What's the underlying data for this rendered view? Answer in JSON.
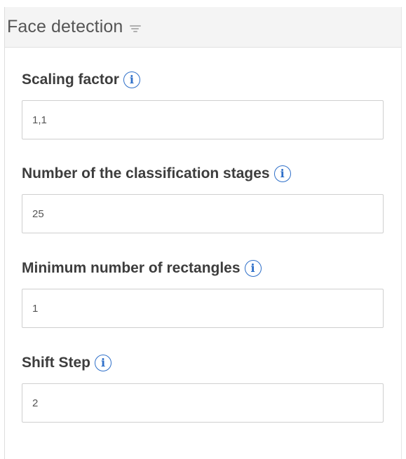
{
  "panel": {
    "title": "Face detection",
    "collapse_icon": "collapse-menu-icon"
  },
  "fields": [
    {
      "label": "Scaling factor",
      "value": "1,1",
      "info_icon": "info-icon"
    },
    {
      "label": "Number of the classification stages",
      "value": "25",
      "info_icon": "info-icon"
    },
    {
      "label": "Minimum number of rectangles",
      "value": "1",
      "info_icon": "info-icon"
    },
    {
      "label": "Shift Step",
      "value": "2",
      "info_icon": "info-icon"
    }
  ],
  "colors": {
    "accent": "#2e6fc9",
    "header_bg": "#f4f4f4",
    "input_border": "#cfcfcf"
  }
}
